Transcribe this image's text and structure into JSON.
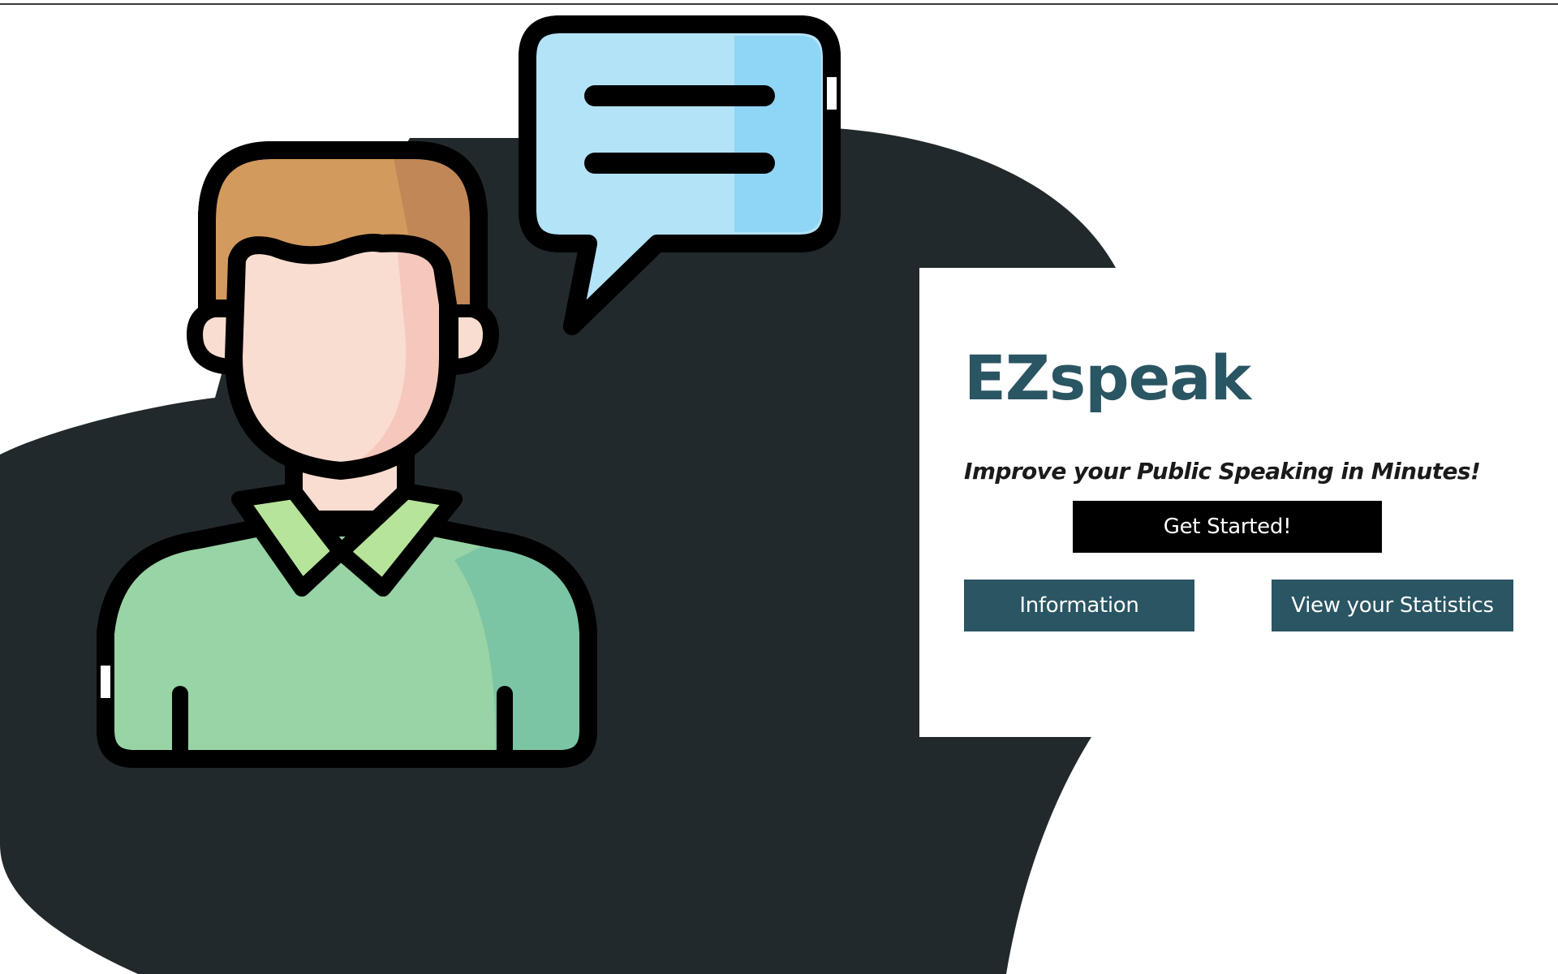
{
  "hero": {
    "title": "EZspeak",
    "tagline": "Improve your Public Speaking in Minutes!"
  },
  "actions": {
    "get_started_label": "Get Started!",
    "information_label": "Information",
    "statistics_label": "View your Statistics"
  },
  "colors": {
    "backdrop_blob": "#22292d",
    "brand_teal": "#2a5563",
    "primary_button": "#000000",
    "hair": "#d39a5e",
    "skin": "#f9ddd0",
    "shirt": "#98d4a5",
    "collar": "#b6e49a",
    "speech_bubble": "#b3e3f7"
  },
  "icons": [
    "person-avatar-icon",
    "speech-bubble-icon"
  ]
}
